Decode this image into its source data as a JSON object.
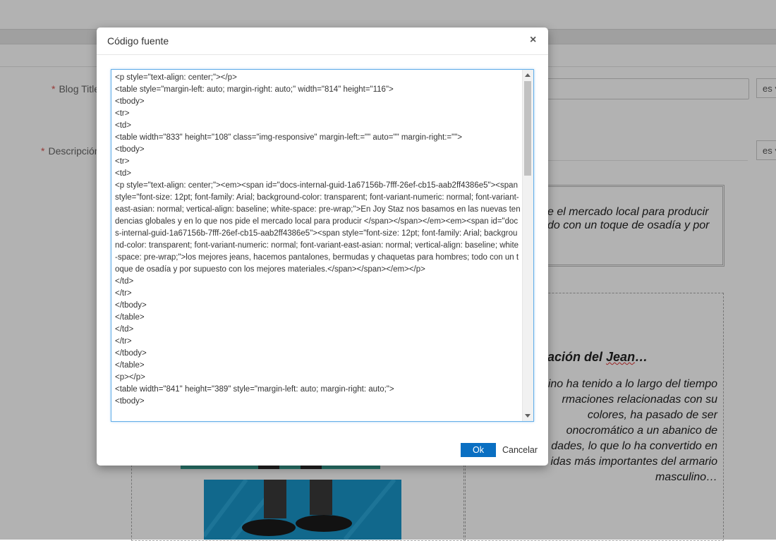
{
  "background": {
    "blog_title_label": "Blog Title",
    "description_label": "Descripción",
    "required_mark": "*",
    "lang_select_1": "es",
    "lang_select_2": "es",
    "content_text_1": "e el mercado local para producir\ndo con un toque de osadía y por",
    "heading_prefix": "ación del ",
    "heading_jean": "Jean",
    "heading_suffix": "…",
    "content_text_2": "ino ha tenido a lo largo del tiempo\nrmaciones relacionadas con su\ncolores, ha pasado de ser\nonocromático a un abanico de\ndades, lo que lo ha convertido en\nidas más importantes del armario\nmasculino…"
  },
  "modal": {
    "title": "Código fuente",
    "close_symbol": "×",
    "source_code": "<p style=\"text-align: center;\"></p>\n<table style=\"margin-left: auto; margin-right: auto;\" width=\"814\" height=\"116\">\n<tbody>\n<tr>\n<td>\n<table width=\"833\" height=\"108\" class=\"img-responsive\" margin-left:=\"\" auto=\"\" margin-right:=\"\">\n<tbody>\n<tr>\n<td>\n<p style=\"text-align: center;\"><em><span id=\"docs-internal-guid-1a67156b-7fff-26ef-cb15-aab2ff4386e5\"><span style=\"font-size: 12pt; font-family: Arial; background-color: transparent; font-variant-numeric: normal; font-variant-east-asian: normal; vertical-align: baseline; white-space: pre-wrap;\">En Joy Staz nos basamos en las nuevas tendencias globales y en lo que nos pide el mercado local para producir </span></span></em><em><span id=\"docs-internal-guid-1a67156b-7fff-26ef-cb15-aab2ff4386e5\"><span style=\"font-size: 12pt; font-family: Arial; background-color: transparent; font-variant-numeric: normal; font-variant-east-asian: normal; vertical-align: baseline; white-space: pre-wrap;\">los mejores jeans, hacemos pantalones, bermudas y chaquetas para hombres; todo con un toque de osadía y por supuesto con los mejores materiales.</span></span></em></p>\n</td>\n</tr>\n</tbody>\n</table>\n</td>\n</tr>\n</tbody>\n</table>\n<p></p>\n<table width=\"841\" height=\"389\" style=\"margin-left: auto; margin-right: auto;\">\n<tbody>",
    "ok_label": "Ok",
    "cancel_label": "Cancelar"
  },
  "colors": {
    "primary_button": "#0a6fc2",
    "focus_border": "#66afe9",
    "required": "#d9534f"
  }
}
